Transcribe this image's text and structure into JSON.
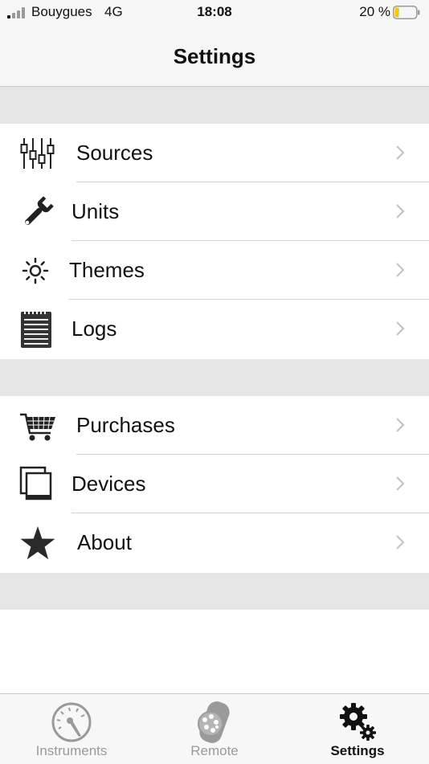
{
  "status_bar": {
    "carrier": "Bouygues",
    "network": "4G",
    "time": "18:08",
    "battery_percent": "20 %",
    "battery_level": 0.2
  },
  "nav": {
    "title": "Settings"
  },
  "sections": [
    {
      "items": [
        {
          "label": "Sources",
          "icon": "sliders-icon"
        },
        {
          "label": "Units",
          "icon": "wrench-icon"
        },
        {
          "label": "Themes",
          "icon": "sun-icon"
        },
        {
          "label": "Logs",
          "icon": "notepad-icon"
        }
      ]
    },
    {
      "items": [
        {
          "label": "Purchases",
          "icon": "cart-icon"
        },
        {
          "label": "Devices",
          "icon": "devices-icon"
        },
        {
          "label": "About",
          "icon": "star-icon"
        }
      ]
    }
  ],
  "tab_bar": {
    "tabs": [
      {
        "label": "Instruments",
        "icon": "gauge-icon",
        "active": false
      },
      {
        "label": "Remote",
        "icon": "remote-icon",
        "active": false
      },
      {
        "label": "Settings",
        "icon": "gears-icon",
        "active": true
      }
    ]
  },
  "colors": {
    "section_gap": "#e6e6e6",
    "separator": "#d4d4d4",
    "chevron": "#c4c4c7",
    "tab_inactive": "#9a9a9a",
    "tab_active": "#111111",
    "battery_fill": "#f7c600"
  }
}
